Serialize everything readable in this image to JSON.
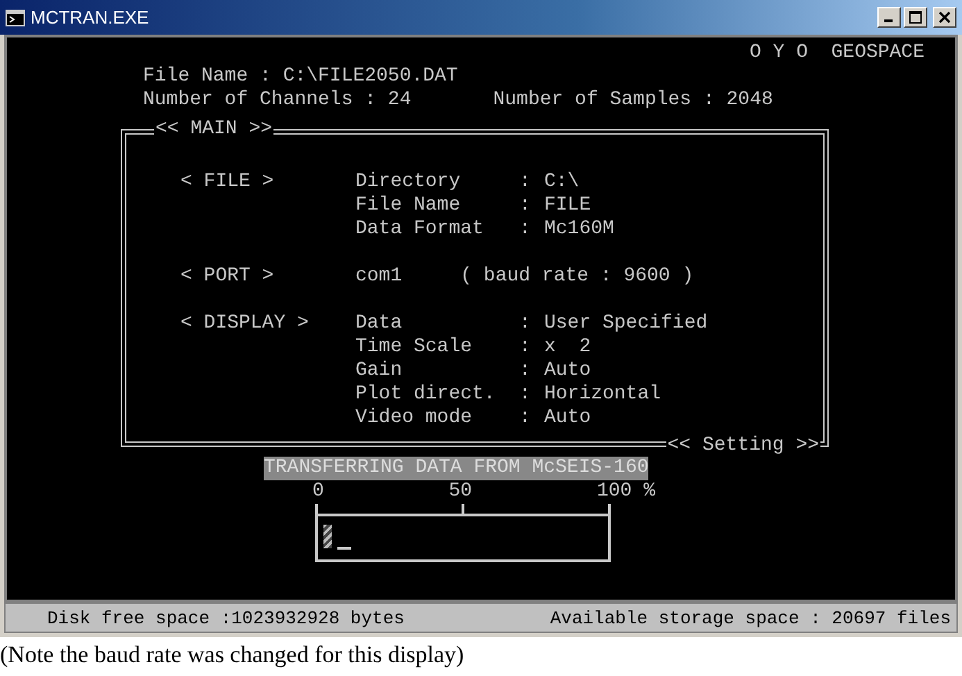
{
  "window": {
    "title": "MCTRAN.EXE"
  },
  "header": {
    "brand": "O Y O  GEOSPACE"
  },
  "file_info": {
    "file_name": "File Name : C:\\FILE2050.DAT",
    "channels": "Number of Channels : 24",
    "samples": "Number of Samples : 2048"
  },
  "main_box": {
    "title": "<< MAIN >>",
    "footer": "<< Setting >>",
    "sections": [
      {
        "label": "< FILE >",
        "rows": [
          {
            "kind": "field",
            "key": "Directory",
            "sep": ":",
            "value": "C:\\"
          },
          {
            "kind": "field",
            "key": "File Name",
            "sep": ":",
            "value": "FILE"
          },
          {
            "kind": "field",
            "key": "Data Format",
            "sep": ":",
            "value": "Mc160M"
          }
        ]
      },
      {
        "label": "< PORT >",
        "rows": [
          {
            "kind": "inline",
            "key": "com1",
            "value": "( baud rate : 9600 )"
          }
        ]
      },
      {
        "label": "< DISPLAY >",
        "rows": [
          {
            "kind": "field",
            "key": "Data",
            "sep": ":",
            "value": "User Specified"
          },
          {
            "kind": "field",
            "key": "Time Scale",
            "sep": ":",
            "value": "x  2"
          },
          {
            "kind": "field",
            "key": "Gain",
            "sep": ":",
            "value": "Auto"
          },
          {
            "kind": "field",
            "key": "Plot direct.",
            "sep": ":",
            "value": "Horizontal"
          },
          {
            "kind": "field",
            "key": "Video mode",
            "sep": ":",
            "value": "Auto"
          }
        ]
      }
    ]
  },
  "progress": {
    "caption": "TRANSFERRING DATA FROM McSEIS-160",
    "scale": [
      "0",
      "50",
      "100 %"
    ],
    "level": 0.03
  },
  "status_bar": {
    "disk": "Disk free space :1023932928 bytes",
    "storage": "Available storage space : 20697 files"
  },
  "caption": "(Note the baud rate was changed for this display)"
}
